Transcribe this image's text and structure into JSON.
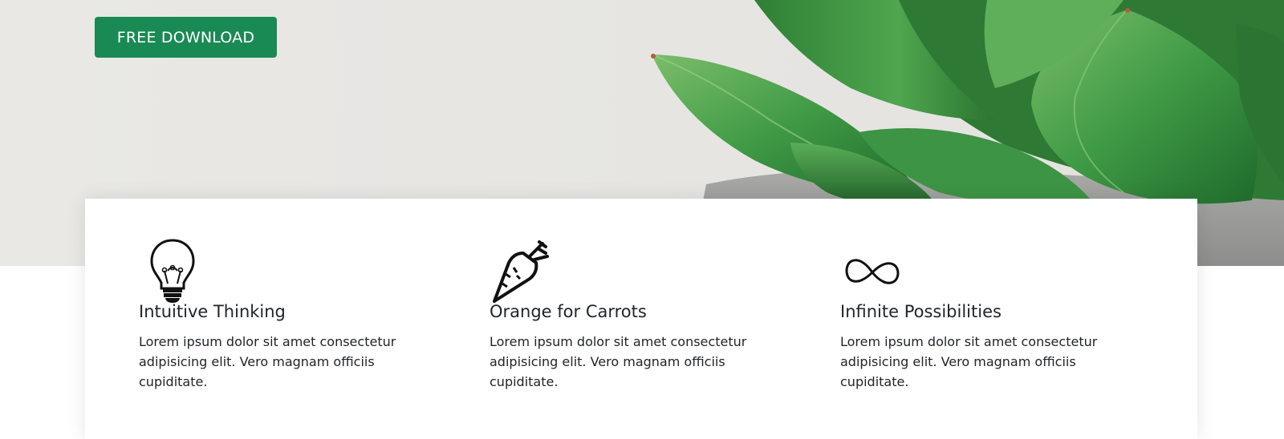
{
  "hero": {
    "button_label": "FREE DOWNLOAD"
  },
  "features": [
    {
      "icon": "lightbulb-icon",
      "title": "Intuitive Thinking",
      "text": "Lorem ipsum dolor sit amet consectetur adipisicing elit. Vero magnam officiis cupiditate."
    },
    {
      "icon": "carrot-icon",
      "title": "Orange for Carrots",
      "text": "Lorem ipsum dolor sit amet consectetur adipisicing elit. Vero magnam officiis cupiditate."
    },
    {
      "icon": "infinity-icon",
      "title": "Infinite Possibilities",
      "text": "Lorem ipsum dolor sit amet consectetur adipisicing elit. Vero magnam officiis cupiditate."
    }
  ],
  "colors": {
    "accent": "#1a8a55",
    "hero_background": "#e8e7e4",
    "text": "#212529"
  }
}
